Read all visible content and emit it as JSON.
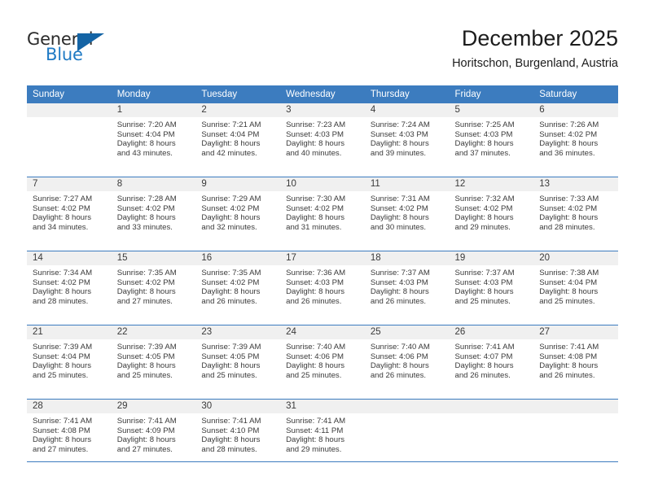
{
  "brand": {
    "name_top": "General",
    "name_bottom": "Blue",
    "color_dark": "#2b2b2b",
    "color_blue": "#1f7ac4",
    "triangle_color": "#1464a5"
  },
  "header": {
    "title": "December 2025",
    "subtitle": "Horitschon, Burgenland, Austria"
  },
  "theme": {
    "header_bg": "#3c7cbf",
    "header_text": "#ffffff",
    "daynum_bg": "#f0f0f0",
    "cell_bg": "#ffffff",
    "text": "#3a3a3a"
  },
  "weekdays": [
    "Sunday",
    "Monday",
    "Tuesday",
    "Wednesday",
    "Thursday",
    "Friday",
    "Saturday"
  ],
  "weeks": [
    [
      {
        "day": "",
        "sunrise": "",
        "sunset": "",
        "daylight_line1": "",
        "daylight_line2": ""
      },
      {
        "day": "1",
        "sunrise": "Sunrise: 7:20 AM",
        "sunset": "Sunset: 4:04 PM",
        "daylight_line1": "Daylight: 8 hours",
        "daylight_line2": "and 43 minutes."
      },
      {
        "day": "2",
        "sunrise": "Sunrise: 7:21 AM",
        "sunset": "Sunset: 4:04 PM",
        "daylight_line1": "Daylight: 8 hours",
        "daylight_line2": "and 42 minutes."
      },
      {
        "day": "3",
        "sunrise": "Sunrise: 7:23 AM",
        "sunset": "Sunset: 4:03 PM",
        "daylight_line1": "Daylight: 8 hours",
        "daylight_line2": "and 40 minutes."
      },
      {
        "day": "4",
        "sunrise": "Sunrise: 7:24 AM",
        "sunset": "Sunset: 4:03 PM",
        "daylight_line1": "Daylight: 8 hours",
        "daylight_line2": "and 39 minutes."
      },
      {
        "day": "5",
        "sunrise": "Sunrise: 7:25 AM",
        "sunset": "Sunset: 4:03 PM",
        "daylight_line1": "Daylight: 8 hours",
        "daylight_line2": "and 37 minutes."
      },
      {
        "day": "6",
        "sunrise": "Sunrise: 7:26 AM",
        "sunset": "Sunset: 4:02 PM",
        "daylight_line1": "Daylight: 8 hours",
        "daylight_line2": "and 36 minutes."
      }
    ],
    [
      {
        "day": "7",
        "sunrise": "Sunrise: 7:27 AM",
        "sunset": "Sunset: 4:02 PM",
        "daylight_line1": "Daylight: 8 hours",
        "daylight_line2": "and 34 minutes."
      },
      {
        "day": "8",
        "sunrise": "Sunrise: 7:28 AM",
        "sunset": "Sunset: 4:02 PM",
        "daylight_line1": "Daylight: 8 hours",
        "daylight_line2": "and 33 minutes."
      },
      {
        "day": "9",
        "sunrise": "Sunrise: 7:29 AM",
        "sunset": "Sunset: 4:02 PM",
        "daylight_line1": "Daylight: 8 hours",
        "daylight_line2": "and 32 minutes."
      },
      {
        "day": "10",
        "sunrise": "Sunrise: 7:30 AM",
        "sunset": "Sunset: 4:02 PM",
        "daylight_line1": "Daylight: 8 hours",
        "daylight_line2": "and 31 minutes."
      },
      {
        "day": "11",
        "sunrise": "Sunrise: 7:31 AM",
        "sunset": "Sunset: 4:02 PM",
        "daylight_line1": "Daylight: 8 hours",
        "daylight_line2": "and 30 minutes."
      },
      {
        "day": "12",
        "sunrise": "Sunrise: 7:32 AM",
        "sunset": "Sunset: 4:02 PM",
        "daylight_line1": "Daylight: 8 hours",
        "daylight_line2": "and 29 minutes."
      },
      {
        "day": "13",
        "sunrise": "Sunrise: 7:33 AM",
        "sunset": "Sunset: 4:02 PM",
        "daylight_line1": "Daylight: 8 hours",
        "daylight_line2": "and 28 minutes."
      }
    ],
    [
      {
        "day": "14",
        "sunrise": "Sunrise: 7:34 AM",
        "sunset": "Sunset: 4:02 PM",
        "daylight_line1": "Daylight: 8 hours",
        "daylight_line2": "and 28 minutes."
      },
      {
        "day": "15",
        "sunrise": "Sunrise: 7:35 AM",
        "sunset": "Sunset: 4:02 PM",
        "daylight_line1": "Daylight: 8 hours",
        "daylight_line2": "and 27 minutes."
      },
      {
        "day": "16",
        "sunrise": "Sunrise: 7:35 AM",
        "sunset": "Sunset: 4:02 PM",
        "daylight_line1": "Daylight: 8 hours",
        "daylight_line2": "and 26 minutes."
      },
      {
        "day": "17",
        "sunrise": "Sunrise: 7:36 AM",
        "sunset": "Sunset: 4:03 PM",
        "daylight_line1": "Daylight: 8 hours",
        "daylight_line2": "and 26 minutes."
      },
      {
        "day": "18",
        "sunrise": "Sunrise: 7:37 AM",
        "sunset": "Sunset: 4:03 PM",
        "daylight_line1": "Daylight: 8 hours",
        "daylight_line2": "and 26 minutes."
      },
      {
        "day": "19",
        "sunrise": "Sunrise: 7:37 AM",
        "sunset": "Sunset: 4:03 PM",
        "daylight_line1": "Daylight: 8 hours",
        "daylight_line2": "and 25 minutes."
      },
      {
        "day": "20",
        "sunrise": "Sunrise: 7:38 AM",
        "sunset": "Sunset: 4:04 PM",
        "daylight_line1": "Daylight: 8 hours",
        "daylight_line2": "and 25 minutes."
      }
    ],
    [
      {
        "day": "21",
        "sunrise": "Sunrise: 7:39 AM",
        "sunset": "Sunset: 4:04 PM",
        "daylight_line1": "Daylight: 8 hours",
        "daylight_line2": "and 25 minutes."
      },
      {
        "day": "22",
        "sunrise": "Sunrise: 7:39 AM",
        "sunset": "Sunset: 4:05 PM",
        "daylight_line1": "Daylight: 8 hours",
        "daylight_line2": "and 25 minutes."
      },
      {
        "day": "23",
        "sunrise": "Sunrise: 7:39 AM",
        "sunset": "Sunset: 4:05 PM",
        "daylight_line1": "Daylight: 8 hours",
        "daylight_line2": "and 25 minutes."
      },
      {
        "day": "24",
        "sunrise": "Sunrise: 7:40 AM",
        "sunset": "Sunset: 4:06 PM",
        "daylight_line1": "Daylight: 8 hours",
        "daylight_line2": "and 25 minutes."
      },
      {
        "day": "25",
        "sunrise": "Sunrise: 7:40 AM",
        "sunset": "Sunset: 4:06 PM",
        "daylight_line1": "Daylight: 8 hours",
        "daylight_line2": "and 26 minutes."
      },
      {
        "day": "26",
        "sunrise": "Sunrise: 7:41 AM",
        "sunset": "Sunset: 4:07 PM",
        "daylight_line1": "Daylight: 8 hours",
        "daylight_line2": "and 26 minutes."
      },
      {
        "day": "27",
        "sunrise": "Sunrise: 7:41 AM",
        "sunset": "Sunset: 4:08 PM",
        "daylight_line1": "Daylight: 8 hours",
        "daylight_line2": "and 26 minutes."
      }
    ],
    [
      {
        "day": "28",
        "sunrise": "Sunrise: 7:41 AM",
        "sunset": "Sunset: 4:08 PM",
        "daylight_line1": "Daylight: 8 hours",
        "daylight_line2": "and 27 minutes."
      },
      {
        "day": "29",
        "sunrise": "Sunrise: 7:41 AM",
        "sunset": "Sunset: 4:09 PM",
        "daylight_line1": "Daylight: 8 hours",
        "daylight_line2": "and 27 minutes."
      },
      {
        "day": "30",
        "sunrise": "Sunrise: 7:41 AM",
        "sunset": "Sunset: 4:10 PM",
        "daylight_line1": "Daylight: 8 hours",
        "daylight_line2": "and 28 minutes."
      },
      {
        "day": "31",
        "sunrise": "Sunrise: 7:41 AM",
        "sunset": "Sunset: 4:11 PM",
        "daylight_line1": "Daylight: 8 hours",
        "daylight_line2": "and 29 minutes."
      },
      {
        "day": "",
        "sunrise": "",
        "sunset": "",
        "daylight_line1": "",
        "daylight_line2": ""
      },
      {
        "day": "",
        "sunrise": "",
        "sunset": "",
        "daylight_line1": "",
        "daylight_line2": ""
      },
      {
        "day": "",
        "sunrise": "",
        "sunset": "",
        "daylight_line1": "",
        "daylight_line2": ""
      }
    ]
  ]
}
